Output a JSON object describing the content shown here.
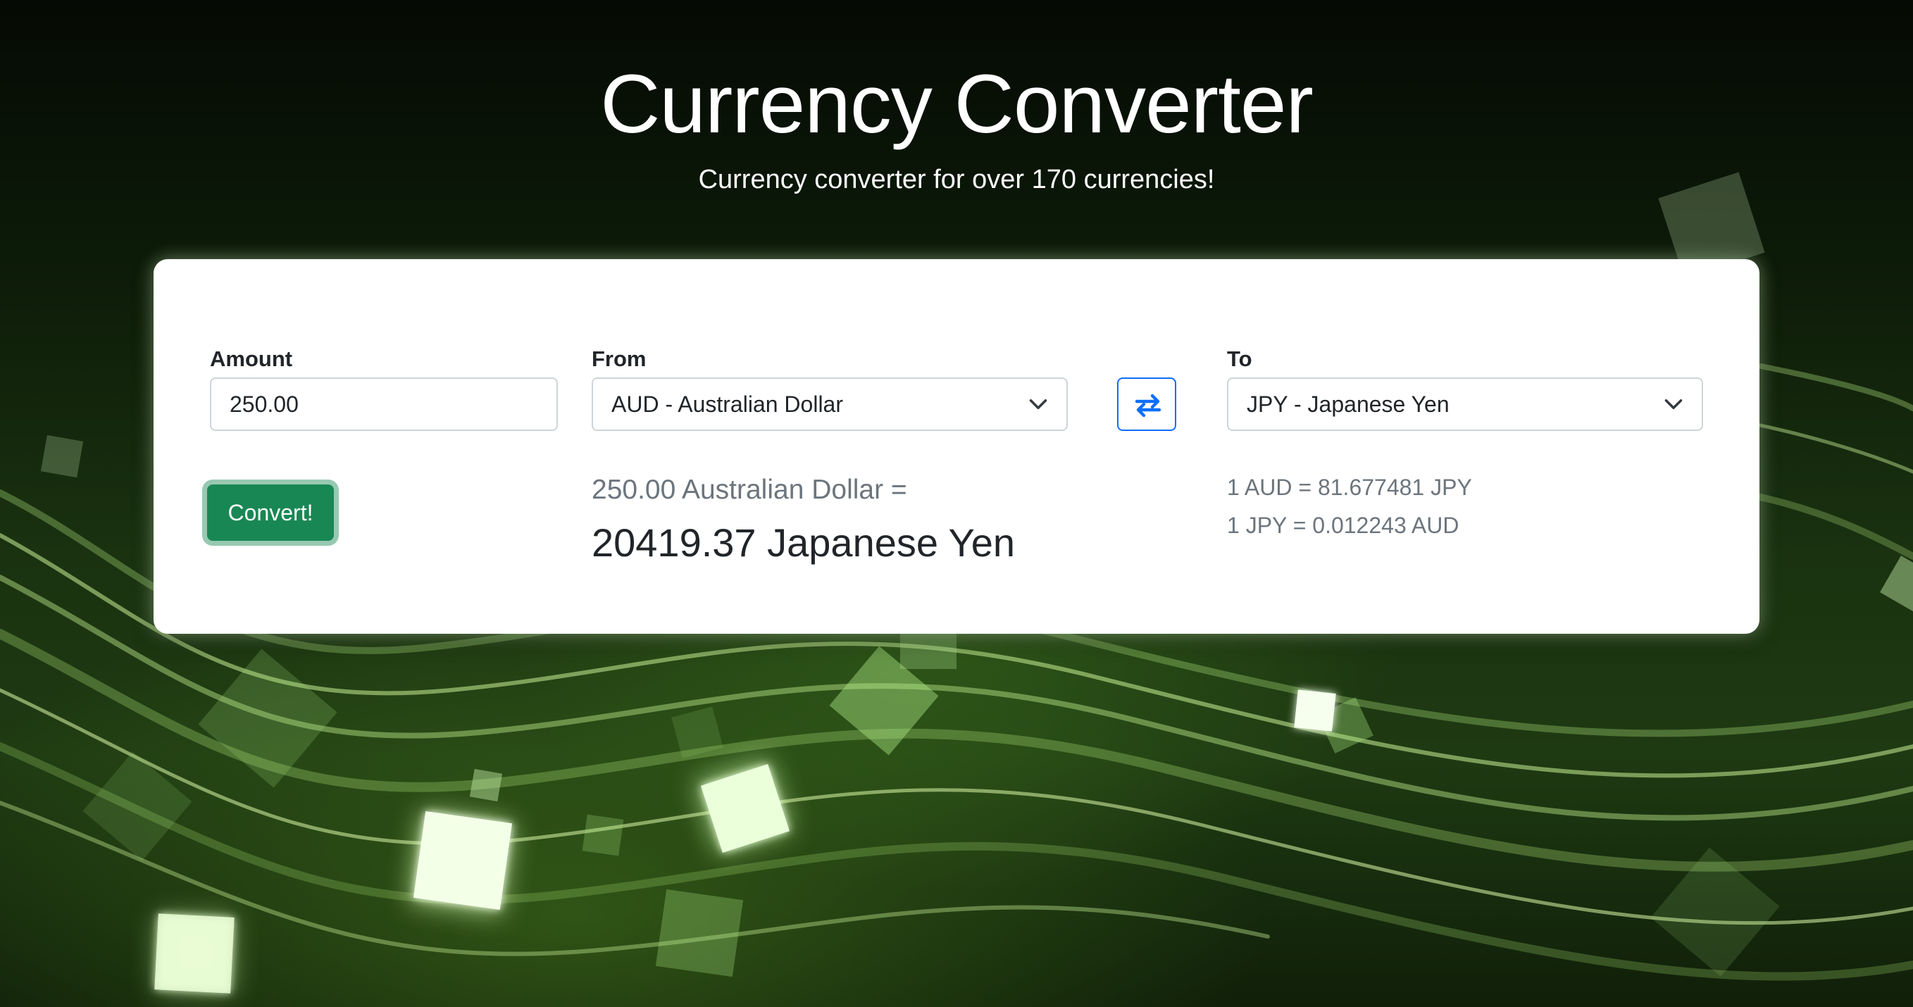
{
  "header": {
    "title": "Currency Converter",
    "subtitle": "Currency converter for over 170 currencies!"
  },
  "form": {
    "amount_label": "Amount",
    "amount_value": "250.00",
    "from_label": "From",
    "from_value": "AUD - Australian Dollar",
    "to_label": "To",
    "to_value": "JPY - Japanese Yen",
    "swap_icon": "swap-arrows-icon",
    "convert_label": "Convert!"
  },
  "result": {
    "from_text": "250.00 Australian Dollar =",
    "to_text": "20419.37 Japanese Yen",
    "rate_forward": "1 AUD = 81.677481 JPY",
    "rate_reverse": "1 JPY = 0.012243 AUD"
  },
  "colors": {
    "convert_button": "#198754",
    "swap_button_border": "#0d6efd",
    "background": "#1a3210"
  }
}
